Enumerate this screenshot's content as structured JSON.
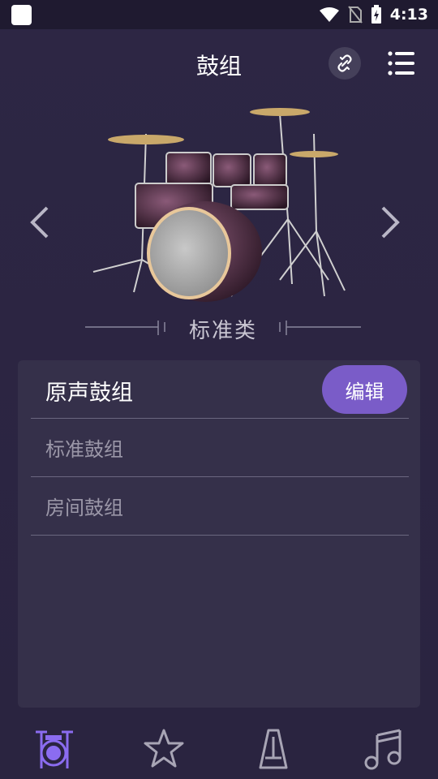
{
  "status_bar": {
    "time": "4:13"
  },
  "header": {
    "title": "鼓组"
  },
  "category": {
    "label": "标准类"
  },
  "kit_list": {
    "items": [
      {
        "label": "原声鼓组",
        "selected": true
      },
      {
        "label": "标准鼓组",
        "selected": false
      },
      {
        "label": "房间鼓组",
        "selected": false
      }
    ],
    "edit_label": "编辑"
  },
  "colors": {
    "accent": "#7a5cc8",
    "background": "#2b2440",
    "panel": "#35304a",
    "active_tab": "#8b6cf0",
    "inactive_tab": "#a8a5b5"
  },
  "bottom_nav": {
    "tabs": [
      {
        "icon": "drum-kit-icon",
        "active": true
      },
      {
        "icon": "star-icon",
        "active": false
      },
      {
        "icon": "metronome-icon",
        "active": false
      },
      {
        "icon": "music-note-icon",
        "active": false
      }
    ]
  }
}
